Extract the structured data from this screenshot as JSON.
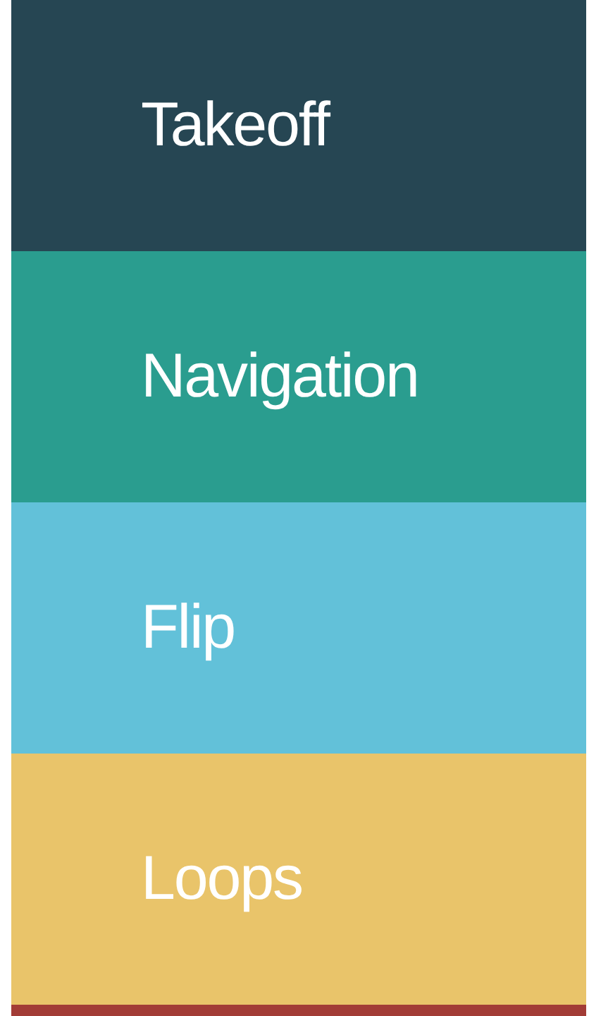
{
  "menu": {
    "items": [
      {
        "label": "Takeoff",
        "color": "#264653"
      },
      {
        "label": "Navigation",
        "color": "#2a9d8f"
      },
      {
        "label": "Flip",
        "color": "#62c1d9"
      },
      {
        "label": "Loops",
        "color": "#e9c46a"
      },
      {
        "color": "#a23c36"
      }
    ]
  }
}
